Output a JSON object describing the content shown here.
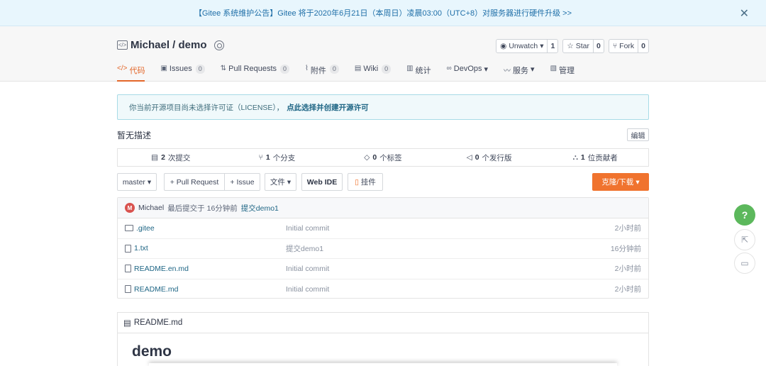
{
  "notice": {
    "text": "【Gitee 系统维护公告】Gitee 将于2020年6月21日（本周日）凌晨03:00（UTC+8）对服务器进行硬件升级 >>",
    "close": "✕"
  },
  "repo": {
    "owner_name": "Michael / demo",
    "watch_label": "Unwatch",
    "watch_count": "1",
    "star_label": "Star",
    "star_count": "0",
    "fork_label": "Fork",
    "fork_count": "0"
  },
  "tabs": [
    {
      "label": "代码",
      "icon": "code-icon"
    },
    {
      "label": "Issues",
      "count": "0",
      "icon": "issues-icon"
    },
    {
      "label": "Pull Requests",
      "count": "0",
      "icon": "pull-request-icon"
    },
    {
      "label": "附件",
      "count": "0",
      "icon": "attachment-icon"
    },
    {
      "label": "Wiki",
      "count": "0",
      "icon": "wiki-icon"
    },
    {
      "label": "统计",
      "icon": "stats-icon"
    },
    {
      "label": "DevOps",
      "icon": "devops-icon"
    },
    {
      "label": "服务",
      "icon": "service-icon"
    },
    {
      "label": "管理",
      "icon": "manage-icon"
    }
  ],
  "license": {
    "text": "你当前开源项目尚未选择许可证（LICENSE），",
    "link": "点此选择并创建开源许可"
  },
  "description": "暂无描述",
  "edit_label": "编辑",
  "stats": [
    {
      "num": "2",
      "label": "次提交"
    },
    {
      "num": "1",
      "label": "个分支"
    },
    {
      "num": "0",
      "label": "个标签"
    },
    {
      "num": "0",
      "label": "个发行版"
    },
    {
      "num": "1",
      "label": "位贡献者"
    }
  ],
  "toolbar": {
    "branch": "master",
    "pull_request": "+ Pull Request",
    "issue": "+ Issue",
    "file": "文件",
    "web_ide": "Web IDE",
    "attach": "挂件",
    "clone": "克隆/下载"
  },
  "commit": {
    "avatar_letter": "M",
    "author": "Michael",
    "meta": "最后提交于 16分钟前",
    "message": "提交demo1"
  },
  "files": [
    {
      "name": ".gitee",
      "type": "folder",
      "message": "Initial commit",
      "time": "2小时前"
    },
    {
      "name": "1.txt",
      "type": "file",
      "message": "提交demo1",
      "time": "16分钟前"
    },
    {
      "name": "README.en.md",
      "type": "file",
      "message": "Initial commit",
      "time": "2小时前"
    },
    {
      "name": "README.md",
      "type": "file",
      "message": "Initial commit",
      "time": "2小时前"
    }
  ],
  "readme": {
    "filename": "README.md",
    "heading": "demo"
  },
  "float": {
    "help": "?"
  }
}
